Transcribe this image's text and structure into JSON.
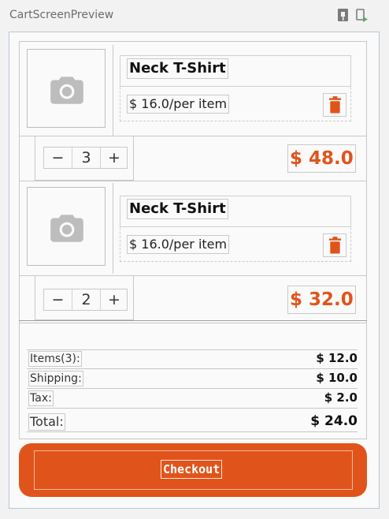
{
  "window": {
    "title": "CartScreenPreview",
    "toolbar_icons": [
      "pin-preview-icon",
      "deploy-preview-icon"
    ]
  },
  "theme": {
    "accent": "#e0541b",
    "product_image_placeholder": "camera-icon"
  },
  "cart": {
    "items": [
      {
        "name": "Neck T-Shirt",
        "unit_price": "$ 16.0/per item",
        "quantity": "3",
        "total": "$ 48.0",
        "minus": "−",
        "plus": "+"
      },
      {
        "name": "Neck T-Shirt",
        "unit_price": "$ 16.0/per item",
        "quantity": "2",
        "total": "$ 32.0",
        "minus": "−",
        "plus": "+"
      }
    ]
  },
  "summary": {
    "items_label": "Items(3):",
    "items_value": "$ 12.0",
    "shipping_label": "Shipping:",
    "shipping_value": "$ 10.0",
    "tax_label": "Tax:",
    "tax_value": "$ 2.0",
    "total_label": "Total:",
    "total_value": "$ 24.0"
  },
  "checkout": {
    "label": "Checkout"
  }
}
